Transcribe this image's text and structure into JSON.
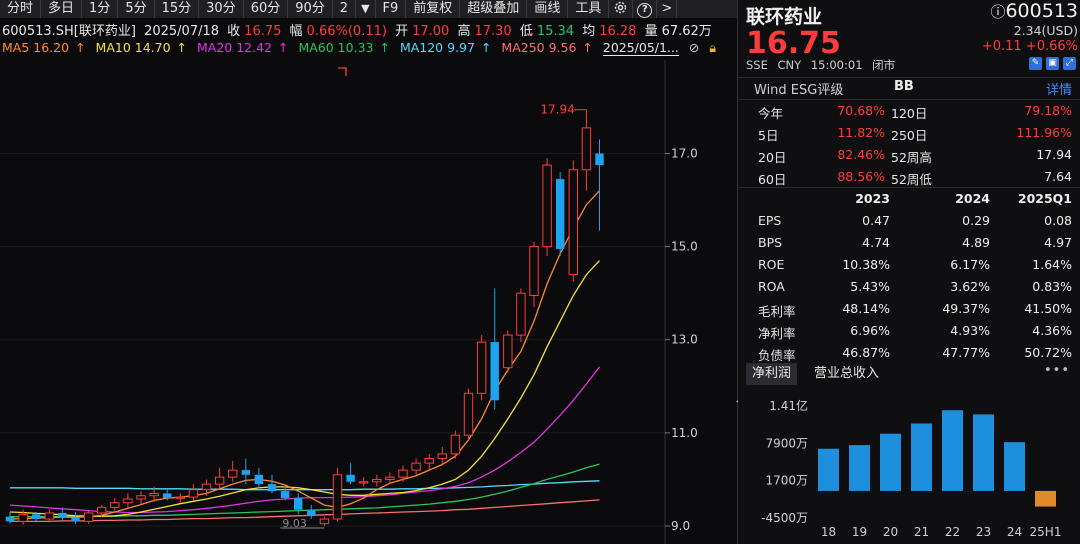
{
  "toolbar": {
    "items": [
      "分时",
      "多日",
      "1分",
      "5分",
      "15分",
      "30分",
      "60分",
      "90分",
      "2",
      "▼",
      "F9",
      "前复权",
      "超级叠加",
      "画线",
      "工具"
    ],
    "help": "?",
    "next": ">"
  },
  "info": {
    "code_name": "600513.SH[联环药业]",
    "date": "2025/07/18",
    "close_label": "收",
    "close": "16.75",
    "amp_label": "幅",
    "amp": "0.66%(0.11)",
    "open_label": "开",
    "open": "17.00",
    "high_label": "高",
    "high": "17.30",
    "low_label": "低",
    "low": "15.34",
    "avg_label": "均",
    "avg": "16.28",
    "vol_label": "量",
    "vol": "67.62万"
  },
  "ma_legend": {
    "ma5": "MA5 16.20",
    "ma10": "MA10 14.70",
    "ma20": "MA20 12.42",
    "ma60": "MA60 10.33",
    "ma120": "MA120 9.97",
    "ma250": "MA250 9.56",
    "arrow": "↑",
    "date": "2025/05/1..."
  },
  "colors": {
    "up": "#ff3b3b",
    "down": "#1fa3f0",
    "ma5": "#ff8a2a",
    "ma10": "#f3e03a",
    "ma20": "#e132e6",
    "ma60": "#2bc45b",
    "ma120": "#56d8ff",
    "ma250": "#ff6d6d",
    "bar": "#1e8fdd",
    "bar_neg": "#e08a2b",
    "link": "#3d8bff"
  },
  "chart_data": {
    "type": "candlestick",
    "y_ticks": [
      "17.0",
      "15.0",
      "13.0",
      "11.0",
      "9.0"
    ],
    "ylim": [
      8.85,
      18.9
    ],
    "max_label": "17.94",
    "min_label": "9.03",
    "candles": [
      {
        "o": 9.2,
        "h": 9.3,
        "l": 9.05,
        "c": 9.1
      },
      {
        "o": 9.1,
        "h": 9.35,
        "l": 9.03,
        "c": 9.25
      },
      {
        "o": 9.25,
        "h": 9.3,
        "l": 9.1,
        "c": 9.15
      },
      {
        "o": 9.15,
        "h": 9.35,
        "l": 9.08,
        "c": 9.28
      },
      {
        "o": 9.28,
        "h": 9.4,
        "l": 9.12,
        "c": 9.18
      },
      {
        "o": 9.18,
        "h": 9.3,
        "l": 9.05,
        "c": 9.1
      },
      {
        "o": 9.1,
        "h": 9.35,
        "l": 9.05,
        "c": 9.28
      },
      {
        "o": 9.28,
        "h": 9.45,
        "l": 9.2,
        "c": 9.4
      },
      {
        "o": 9.4,
        "h": 9.6,
        "l": 9.3,
        "c": 9.5
      },
      {
        "o": 9.5,
        "h": 9.7,
        "l": 9.4,
        "c": 9.58
      },
      {
        "o": 9.58,
        "h": 9.75,
        "l": 9.45,
        "c": 9.65
      },
      {
        "o": 9.65,
        "h": 9.85,
        "l": 9.52,
        "c": 9.7
      },
      {
        "o": 9.7,
        "h": 9.8,
        "l": 9.55,
        "c": 9.6
      },
      {
        "o": 9.6,
        "h": 9.7,
        "l": 9.5,
        "c": 9.62
      },
      {
        "o": 9.62,
        "h": 9.9,
        "l": 9.55,
        "c": 9.78
      },
      {
        "o": 9.78,
        "h": 10.0,
        "l": 9.65,
        "c": 9.9
      },
      {
        "o": 9.9,
        "h": 10.25,
        "l": 9.8,
        "c": 10.05
      },
      {
        "o": 10.05,
        "h": 10.4,
        "l": 9.95,
        "c": 10.2
      },
      {
        "o": 10.2,
        "h": 10.45,
        "l": 9.9,
        "c": 10.1
      },
      {
        "o": 10.1,
        "h": 10.25,
        "l": 9.8,
        "c": 9.9
      },
      {
        "o": 9.9,
        "h": 10.1,
        "l": 9.7,
        "c": 9.75
      },
      {
        "o": 9.75,
        "h": 9.85,
        "l": 9.55,
        "c": 9.6
      },
      {
        "o": 9.6,
        "h": 9.7,
        "l": 9.25,
        "c": 9.35
      },
      {
        "o": 9.35,
        "h": 9.45,
        "l": 9.15,
        "c": 9.22
      },
      {
        "o": 9.05,
        "h": 9.2,
        "l": 9.0,
        "c": 9.15
      },
      {
        "o": 9.15,
        "h": 10.25,
        "l": 9.1,
        "c": 10.1
      },
      {
        "o": 10.1,
        "h": 10.35,
        "l": 9.9,
        "c": 9.95
      },
      {
        "o": 9.95,
        "h": 10.05,
        "l": 9.85,
        "c": 9.95
      },
      {
        "o": 9.95,
        "h": 10.1,
        "l": 9.85,
        "c": 10.0
      },
      {
        "o": 10.0,
        "h": 10.15,
        "l": 9.9,
        "c": 10.05
      },
      {
        "o": 10.05,
        "h": 10.3,
        "l": 9.95,
        "c": 10.2
      },
      {
        "o": 10.2,
        "h": 10.45,
        "l": 10.1,
        "c": 10.35
      },
      {
        "o": 10.35,
        "h": 10.55,
        "l": 10.2,
        "c": 10.45
      },
      {
        "o": 10.45,
        "h": 10.7,
        "l": 10.3,
        "c": 10.55
      },
      {
        "o": 10.55,
        "h": 11.05,
        "l": 10.45,
        "c": 10.95
      },
      {
        "o": 10.95,
        "h": 11.95,
        "l": 10.85,
        "c": 11.85
      },
      {
        "o": 11.85,
        "h": 13.1,
        "l": 11.7,
        "c": 12.95
      },
      {
        "o": 12.95,
        "h": 14.1,
        "l": 11.5,
        "c": 11.7
      },
      {
        "o": 12.4,
        "h": 13.2,
        "l": 12.3,
        "c": 13.1
      },
      {
        "o": 13.1,
        "h": 14.1,
        "l": 12.95,
        "c": 14.0
      },
      {
        "o": 13.95,
        "h": 15.1,
        "l": 13.7,
        "c": 15.0
      },
      {
        "o": 15.0,
        "h": 16.9,
        "l": 14.8,
        "c": 16.75
      },
      {
        "o": 16.45,
        "h": 16.6,
        "l": 14.8,
        "c": 14.95
      },
      {
        "o": 14.4,
        "h": 16.85,
        "l": 14.25,
        "c": 16.65
      },
      {
        "o": 16.65,
        "h": 17.94,
        "l": 16.2,
        "c": 17.55
      },
      {
        "o": 17.0,
        "h": 17.3,
        "l": 15.34,
        "c": 16.75
      }
    ],
    "ma5": [
      9.15,
      9.16,
      9.17,
      9.18,
      9.19,
      9.19,
      9.2,
      9.23,
      9.3,
      9.38,
      9.46,
      9.55,
      9.6,
      9.62,
      9.65,
      9.7,
      9.8,
      9.9,
      9.98,
      10.0,
      9.96,
      9.88,
      9.75,
      9.6,
      9.45,
      9.4,
      9.48,
      9.6,
      9.78,
      9.92,
      10.0,
      10.08,
      10.2,
      10.32,
      10.5,
      10.85,
      11.3,
      11.9,
      12.35,
      12.75,
      13.4,
      14.2,
      14.85,
      15.4,
      15.9,
      16.2
    ],
    "ma10": [
      9.3,
      9.29,
      9.27,
      9.26,
      9.24,
      9.22,
      9.21,
      9.21,
      9.22,
      9.25,
      9.3,
      9.36,
      9.42,
      9.48,
      9.53,
      9.58,
      9.64,
      9.71,
      9.78,
      9.82,
      9.84,
      9.84,
      9.82,
      9.78,
      9.73,
      9.68,
      9.66,
      9.66,
      9.68,
      9.7,
      9.72,
      9.76,
      9.82,
      9.9,
      10.0,
      10.2,
      10.5,
      10.88,
      11.3,
      11.75,
      12.25,
      12.85,
      13.4,
      13.95,
      14.4,
      14.7
    ],
    "ma20": [
      9.45,
      9.43,
      9.41,
      9.39,
      9.37,
      9.35,
      9.33,
      9.31,
      9.3,
      9.29,
      9.29,
      9.3,
      9.31,
      9.33,
      9.35,
      9.38,
      9.41,
      9.45,
      9.49,
      9.53,
      9.56,
      9.58,
      9.6,
      9.61,
      9.61,
      9.61,
      9.62,
      9.63,
      9.65,
      9.67,
      9.7,
      9.73,
      9.76,
      9.8,
      9.85,
      9.93,
      10.05,
      10.2,
      10.38,
      10.58,
      10.8,
      11.08,
      11.38,
      11.7,
      12.05,
      12.42
    ],
    "ma60": [
      9.2,
      9.2,
      9.2,
      9.2,
      9.2,
      9.2,
      9.2,
      9.21,
      9.21,
      9.22,
      9.22,
      9.23,
      9.23,
      9.24,
      9.25,
      9.26,
      9.27,
      9.28,
      9.29,
      9.3,
      9.31,
      9.32,
      9.33,
      9.34,
      9.35,
      9.36,
      9.37,
      9.38,
      9.39,
      9.41,
      9.43,
      9.45,
      9.47,
      9.5,
      9.53,
      9.57,
      9.62,
      9.68,
      9.75,
      9.83,
      9.91,
      10.0,
      10.08,
      10.16,
      10.25,
      10.33
    ],
    "ma120": [
      9.82,
      9.82,
      9.82,
      9.82,
      9.82,
      9.81,
      9.81,
      9.81,
      9.81,
      9.81,
      9.8,
      9.8,
      9.8,
      9.8,
      9.79,
      9.79,
      9.79,
      9.79,
      9.78,
      9.78,
      9.78,
      9.78,
      9.78,
      9.78,
      9.78,
      9.78,
      9.78,
      9.79,
      9.79,
      9.79,
      9.8,
      9.8,
      9.81,
      9.81,
      9.82,
      9.83,
      9.84,
      9.86,
      9.87,
      9.89,
      9.9,
      9.92,
      9.93,
      9.95,
      9.96,
      9.97
    ],
    "ma250": [
      9.1,
      9.1,
      9.1,
      9.1,
      9.11,
      9.11,
      9.11,
      9.12,
      9.12,
      9.13,
      9.13,
      9.14,
      9.14,
      9.15,
      9.16,
      9.16,
      9.17,
      9.18,
      9.18,
      9.19,
      9.2,
      9.21,
      9.22,
      9.23,
      9.24,
      9.25,
      9.26,
      9.27,
      9.28,
      9.29,
      9.3,
      9.31,
      9.32,
      9.33,
      9.35,
      9.36,
      9.38,
      9.4,
      9.42,
      9.44,
      9.46,
      9.48,
      9.5,
      9.52,
      9.54,
      9.56
    ]
  },
  "panel": {
    "name": "联环药业",
    "code": "600513",
    "price": "16.75",
    "mcap": "2.34(USD)",
    "change": "+0.11  +0.66%",
    "exchange": "SSE",
    "currency": "CNY",
    "time": "15:00:01",
    "status": "闭市",
    "esg_label": "Wind ESG评级",
    "esg_value": "BB",
    "esg_more": "详情",
    "returns": [
      {
        "k1": "今年",
        "v1": "70.68%",
        "k2": "120日",
        "v2": "79.18%",
        "v2_plain": false
      },
      {
        "k1": "5日",
        "v1": "11.82%",
        "k2": "250日",
        "v2": "111.96%",
        "v2_plain": false
      },
      {
        "k1": "20日",
        "v1": "82.46%",
        "k2": "52周高",
        "v2": "17.94",
        "v2_plain": true
      },
      {
        "k1": "60日",
        "v1": "88.56%",
        "k2": "52周低",
        "v2": "7.64",
        "v2_plain": true
      }
    ],
    "fin_header": [
      "",
      "2023",
      "2024",
      "2025Q1"
    ],
    "fin_rows": [
      [
        "EPS",
        "0.47",
        "0.29",
        "0.08"
      ],
      [
        "BPS",
        "4.74",
        "4.89",
        "4.97"
      ],
      [
        "ROE",
        "10.38%",
        "6.17%",
        "1.64%"
      ],
      [
        "ROA",
        "5.43%",
        "3.62%",
        "0.83%"
      ],
      [
        "毛利率",
        "48.14%",
        "49.37%",
        "41.50%"
      ],
      [
        "净利率",
        "6.96%",
        "4.93%",
        "4.36%"
      ],
      [
        "负债率",
        "46.87%",
        "47.77%",
        "50.72%"
      ]
    ],
    "tabs": [
      "净利润",
      "营业总收入"
    ],
    "dots": "•••",
    "bar_chart": {
      "y_ticks": [
        "1.41亿",
        "7900万",
        "1700万",
        "-4500万"
      ],
      "tick_values": [
        14100,
        7900,
        1700,
        -4500
      ],
      "categories": [
        "18",
        "19",
        "20",
        "21",
        "22",
        "23",
        "24",
        "25H1"
      ],
      "values": [
        7000,
        7600,
        9500,
        11200,
        13400,
        12700,
        8100,
        -2600
      ]
    }
  }
}
